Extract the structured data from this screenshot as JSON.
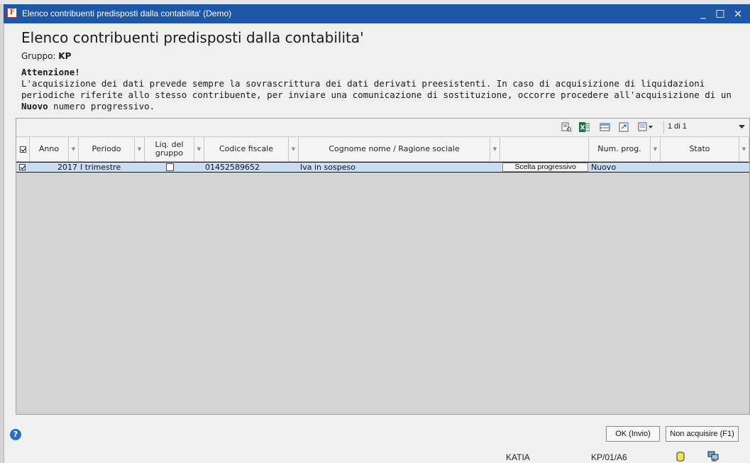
{
  "window": {
    "title": "Elenco contribuenti predisposti dalla contabilita'  (Demo)",
    "minimize": "_",
    "maximize": "□",
    "close": "×"
  },
  "header": {
    "heading": "Elenco contribuenti predisposti dalla contabilita'",
    "gruppo_label": "Gruppo:",
    "gruppo_value": "KP"
  },
  "notice": {
    "title": "Attenzione!",
    "text_part1": "L'acquisizione dei dati  prevede sempre la sovrascrittura dei dati derivati preesistenti. In caso di acquisizione di liquidazioni periodiche riferite allo stesso contribuente, per inviare una comunicazione di sostituzione, occorre procedere all'acquisizione di un ",
    "text_bold": "Nuovo",
    "text_part2": " numero progressivo."
  },
  "toolbar": {
    "icons": [
      "print-preview-icon",
      "excel-export-icon",
      "columns-icon",
      "refresh-icon",
      "filter-settings-icon"
    ],
    "pager": "1 di 1"
  },
  "columns": {
    "anno": "Anno",
    "periodo": "Periodo",
    "liq_gruppo": "Liq. del gruppo",
    "codice_fiscale": "Codice fiscale",
    "cognome_nome": "Cognome nome / Ragione sociale",
    "num_prog": "Num. prog.",
    "stato": "Stato"
  },
  "rows": [
    {
      "selected": true,
      "anno": "2017",
      "periodo": "I trimestre",
      "liq_gruppo": false,
      "codice_fiscale": "01452589652",
      "cognome_nome": "Iva in sospeso",
      "action": "Scelta progressivo",
      "num_prog": "Nuovo",
      "stato": ""
    }
  ],
  "buttons": {
    "ok": "OK (Invio)",
    "non_acquisire": "Non acquisire (F1)",
    "help": "?"
  },
  "statusbar": {
    "user": "KATIA",
    "code": "KP/01/A6"
  }
}
